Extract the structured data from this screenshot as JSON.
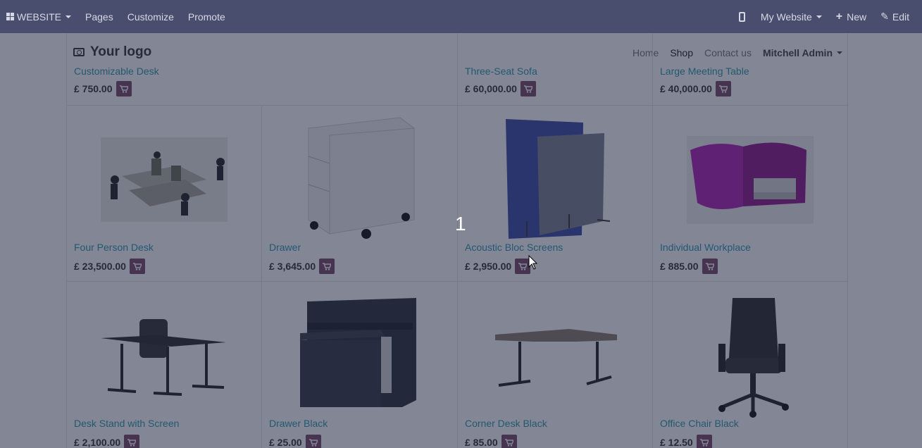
{
  "adminbar": {
    "website_label": "WEBSITE",
    "pages": "Pages",
    "customize": "Customize",
    "promote": "Promote",
    "my_website": "My Website",
    "new": "New",
    "edit": "Edit"
  },
  "header": {
    "logo": "Your logo",
    "nav": {
      "home": "Home",
      "shop": "Shop",
      "contact": "Contact us",
      "user": "Mitchell Admin"
    }
  },
  "products": {
    "row0": [
      {
        "name": "Customizable Desk",
        "price": "£ 750.00"
      },
      {
        "name": "Three-Seat Sofa",
        "price": "£ 60,000.00"
      },
      {
        "name": "Large Meeting Table",
        "price": "£ 40,000.00"
      }
    ],
    "row1": [
      {
        "name": "Four Person Desk",
        "price": "£ 23,500.00"
      },
      {
        "name": "Drawer",
        "price": "£ 3,645.00"
      },
      {
        "name": "Acoustic Bloc Screens",
        "price": "£ 2,950.00"
      },
      {
        "name": "Individual Workplace",
        "price": "£ 885.00"
      }
    ],
    "row2": [
      {
        "name": "Desk Stand with Screen",
        "price": "£ 2,100.00"
      },
      {
        "name": "Drawer Black",
        "price": "£ 25.00"
      },
      {
        "name": "Corner Desk Black",
        "price": "£ 85.00"
      },
      {
        "name": "Office Chair Black",
        "price": "£ 12.50"
      }
    ]
  },
  "tour": {
    "step": "1"
  },
  "colors": {
    "adminbar": "#4a4e6e",
    "link": "#2b9bb0",
    "cart": "#7a4a6a"
  }
}
